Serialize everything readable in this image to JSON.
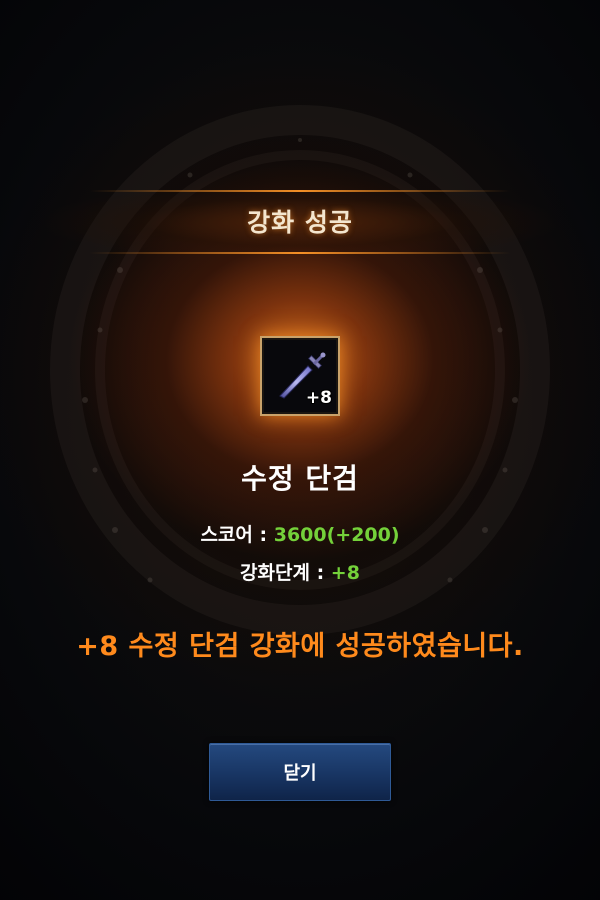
{
  "dialog": {
    "title": "강화 성공"
  },
  "item": {
    "icon": "dagger-icon",
    "level_badge": "+8",
    "name": "수정 단검"
  },
  "stats": {
    "score_label": "스코어 : ",
    "score_value": "3600(+200)",
    "level_label": "강화단계 : ",
    "level_value": "+8"
  },
  "message": "+8 수정 단검 강화에 성공하였습니다.",
  "buttons": {
    "close_label": "닫기"
  },
  "colors": {
    "accent_orange": "#ff8a1c",
    "stat_green": "#74d13a",
    "button_blue": "#183563",
    "title_line": "#ff9628"
  }
}
